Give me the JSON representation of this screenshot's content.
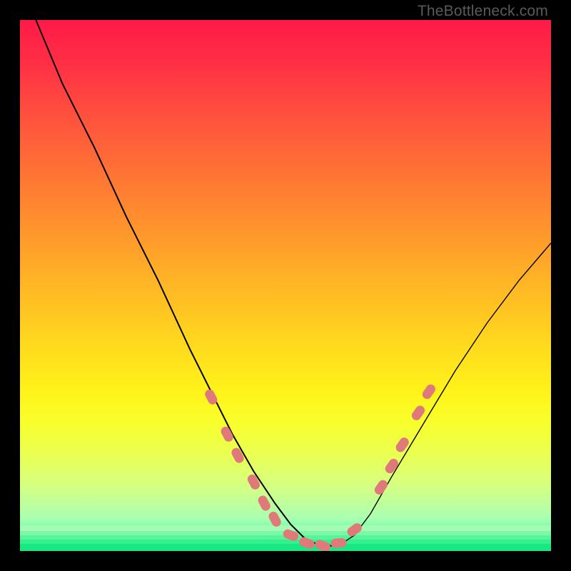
{
  "attribution": "TheBottleneck.com",
  "colors": {
    "frame": "#000000",
    "curve": "#000000",
    "marker_fill": "#e07a7a",
    "marker_stroke": "#c85a5a"
  },
  "chart_data": {
    "type": "line",
    "title": "",
    "xlabel": "",
    "ylabel": "",
    "xlim": [
      0,
      100
    ],
    "ylim": [
      0,
      100
    ],
    "series": [
      {
        "name": "bottleneck-curve",
        "x": [
          3,
          8,
          14,
          20,
          26,
          32,
          36,
          40,
          44,
          48,
          51,
          54,
          57,
          60,
          63,
          66,
          70,
          76,
          82,
          88,
          94,
          100
        ],
        "y": [
          100,
          88,
          76,
          63,
          51,
          38,
          30,
          22,
          15,
          9,
          5,
          2,
          1,
          1,
          3,
          7,
          14,
          24,
          34,
          43,
          51,
          58
        ]
      }
    ],
    "markers": [
      {
        "x": 36,
        "y": 29
      },
      {
        "x": 39,
        "y": 22
      },
      {
        "x": 41,
        "y": 18
      },
      {
        "x": 44,
        "y": 13
      },
      {
        "x": 46,
        "y": 9
      },
      {
        "x": 48,
        "y": 6
      },
      {
        "x": 51,
        "y": 3
      },
      {
        "x": 54,
        "y": 1.5
      },
      {
        "x": 57,
        "y": 1
      },
      {
        "x": 60,
        "y": 1.5
      },
      {
        "x": 63,
        "y": 4
      },
      {
        "x": 68,
        "y": 12
      },
      {
        "x": 70,
        "y": 16
      },
      {
        "x": 72,
        "y": 20
      },
      {
        "x": 75,
        "y": 26
      },
      {
        "x": 77,
        "y": 30
      }
    ]
  }
}
